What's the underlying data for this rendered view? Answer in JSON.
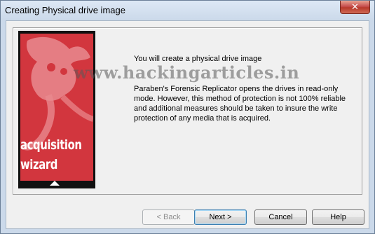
{
  "window": {
    "title": "Creating Physical drive image",
    "close_glyph": "✕"
  },
  "wizard_image": {
    "line1": "acquisition",
    "line2": "wizard"
  },
  "content": {
    "heading": "You will create a physical drive image",
    "body": "Paraben's Forensic Replicator opens the drives in read-only mode. However, this method of protection is not 100% reliable and additional measures should be taken to insure the write protection of any media that is acquired."
  },
  "watermark": "www.hackingarticles.in",
  "buttons": {
    "back": "< Back",
    "next": "Next >",
    "cancel": "Cancel",
    "help": "Help"
  },
  "colors": {
    "wizard_red": "#d2363e",
    "accent": "#3c7fb1"
  }
}
